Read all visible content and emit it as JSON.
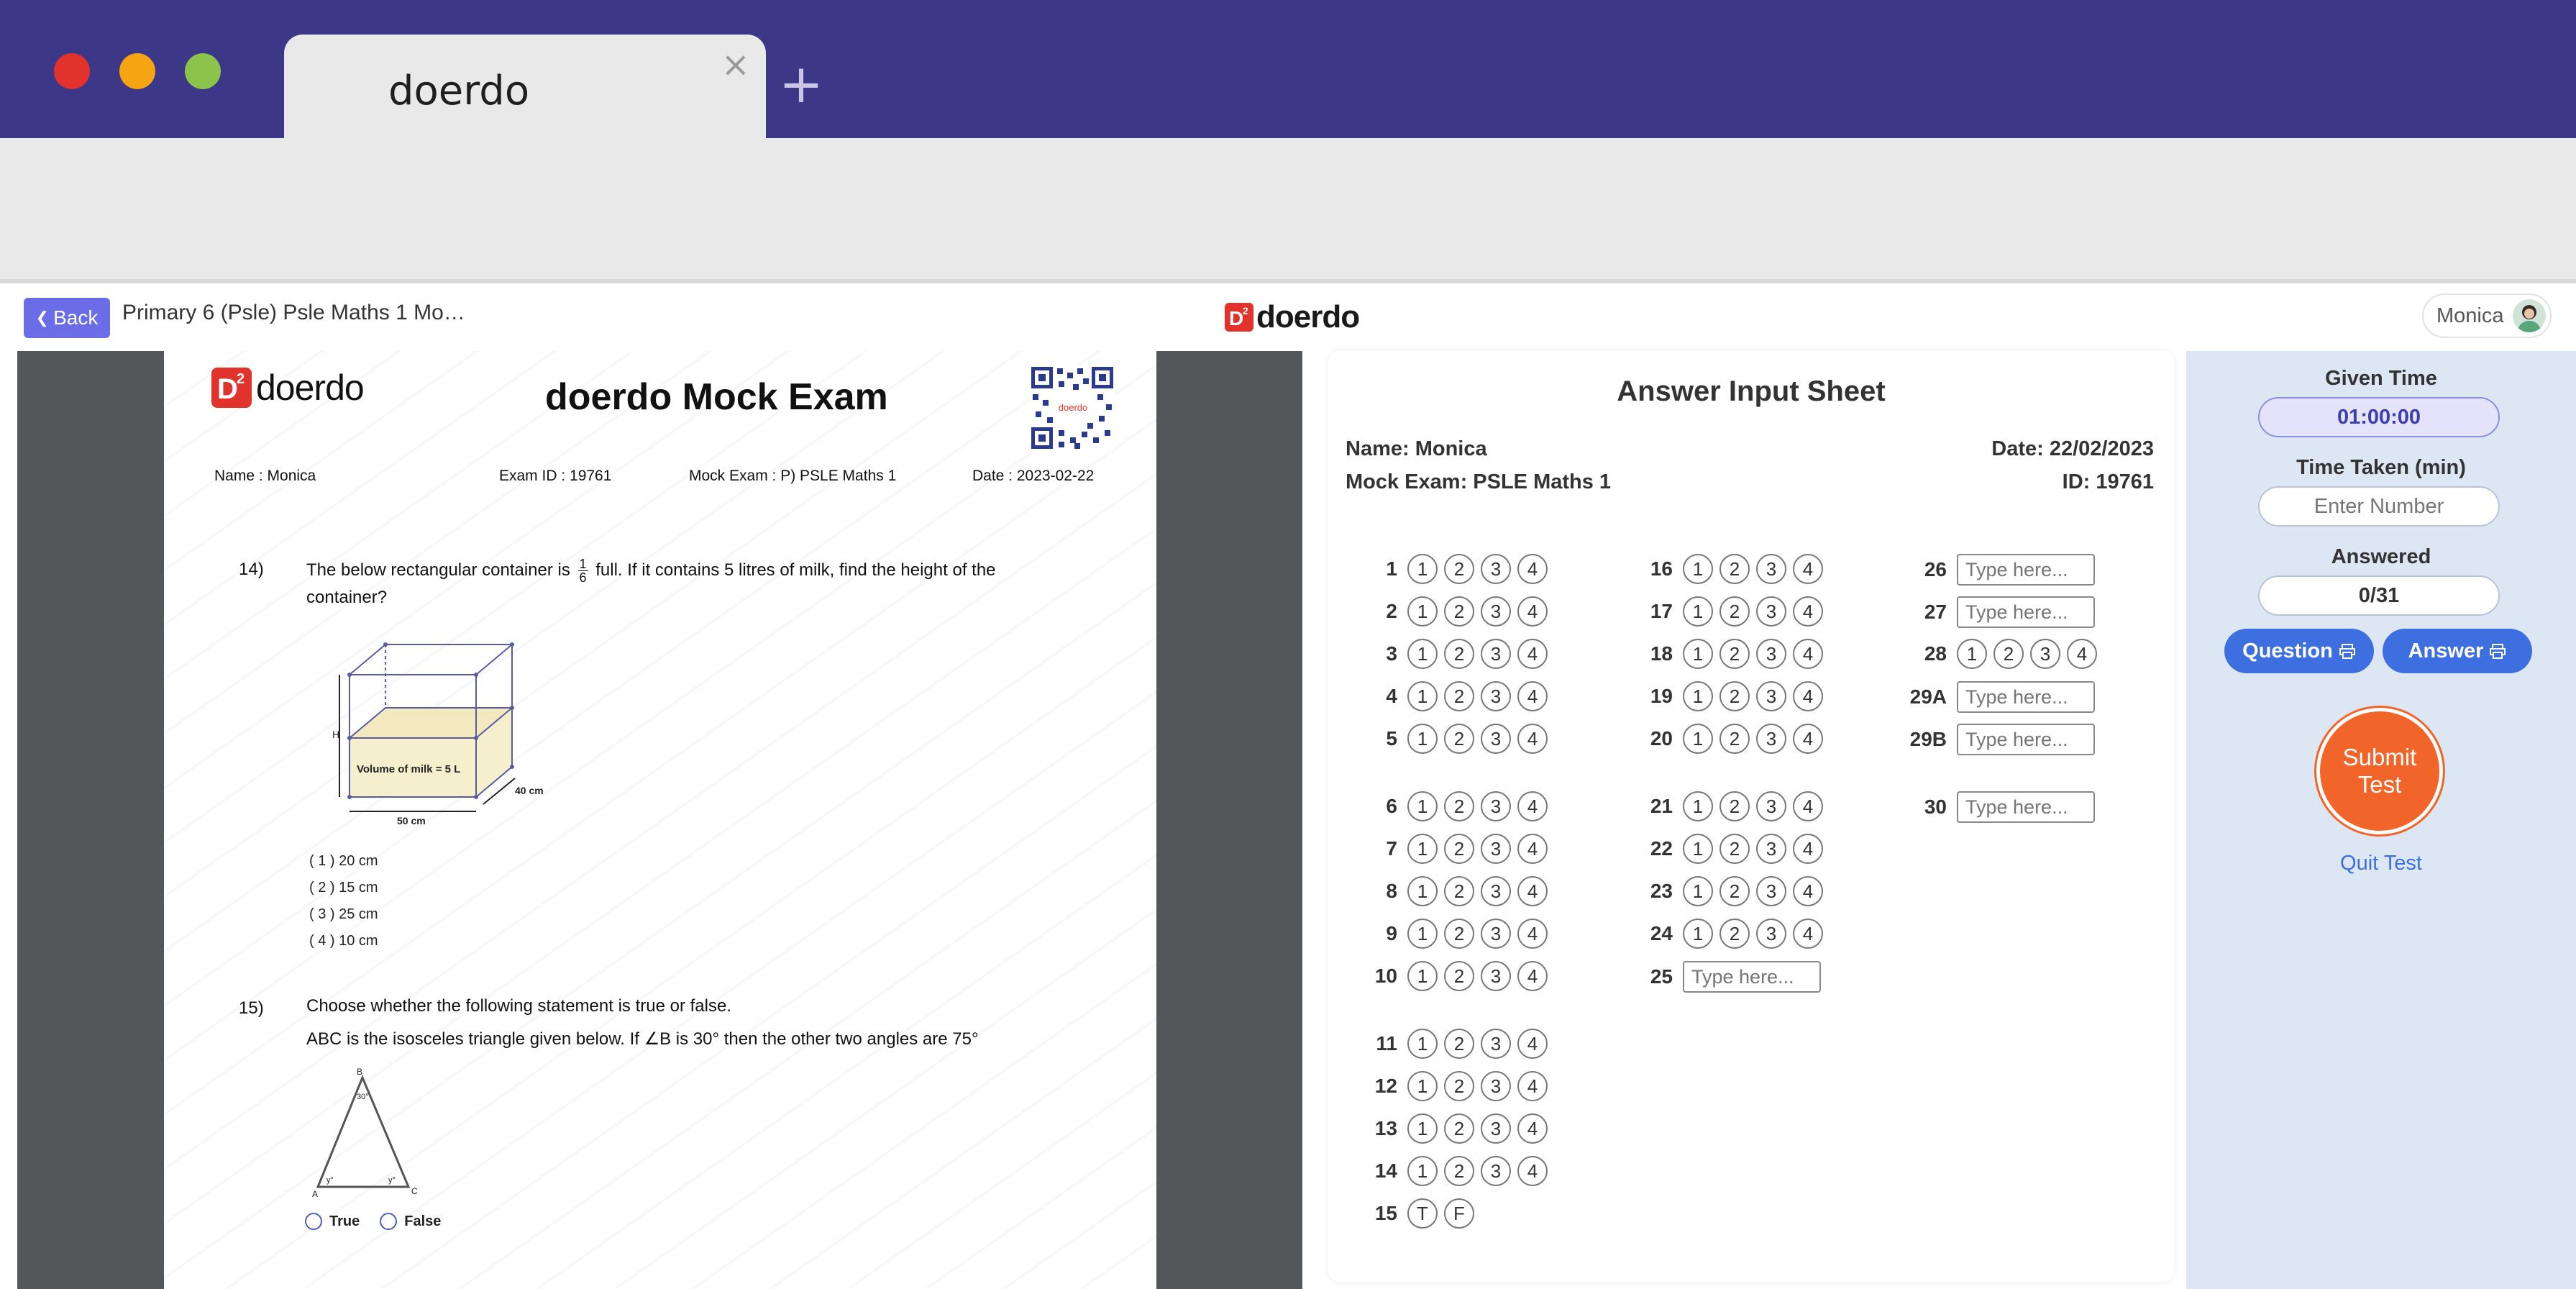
{
  "browser": {
    "tab_title": "doerdo",
    "tab_close": "×",
    "new_tab": "+",
    "url": ""
  },
  "header": {
    "back_label": "Back",
    "doc_title": "Primary 6 (Psle) Psle Maths 1 Mo…",
    "brand": "doerdo",
    "user_name": "Monica"
  },
  "pdf": {
    "logo_text": "doerdo",
    "title": "doerdo Mock Exam",
    "meta": {
      "name": "Name : Monica",
      "exam_id": "Exam ID : 19761",
      "mock_exam": "Mock Exam : P) PSLE Maths 1",
      "date": "Date : 2023-02-22"
    },
    "q14": {
      "num": "14)",
      "text_a": "The below rectangular container is",
      "frac_num": "1",
      "frac_den": "6",
      "text_b": "full. If it contains 5 litres of milk, find the height of the",
      "text_c": "container?",
      "figure": {
        "volume_label": "Volume of milk =   5 L",
        "h_label": "H",
        "width_label": "50 cm",
        "depth_label": "40 cm"
      },
      "options": [
        "( 1 )  20 cm",
        "( 2 )  15 cm",
        "( 3 )  25 cm",
        "( 4 )  10 cm"
      ]
    },
    "q15": {
      "num": "15)",
      "text_a": "Choose whether the following statement is true or false.",
      "text_b": "ABC is the isosceles triangle given below. If ∠B is 30° then the other two angles are 75°",
      "figure": {
        "b": "B",
        "a": "A",
        "c": "C",
        "angle": "30°",
        "y1": "y°",
        "y2": "y°"
      },
      "true_label": "True",
      "false_label": "False"
    }
  },
  "sheet": {
    "title": "Answer Input Sheet",
    "name": "Name: Monica",
    "date": "Date: 22/02/2023",
    "mock_exam": "Mock Exam: PSLE Maths 1",
    "id": "ID: 19761",
    "placeholder": "Type here...",
    "mcq_options": [
      "1",
      "2",
      "3",
      "4"
    ],
    "tf_options": [
      "T",
      "F"
    ],
    "rows": [
      {
        "n": "1"
      },
      {
        "n": "2"
      },
      {
        "n": "3"
      },
      {
        "n": "4"
      },
      {
        "n": "5"
      },
      {
        "n": "6"
      },
      {
        "n": "7"
      },
      {
        "n": "8"
      },
      {
        "n": "9"
      },
      {
        "n": "10"
      },
      {
        "n": "11"
      },
      {
        "n": "12"
      },
      {
        "n": "13"
      },
      {
        "n": "14"
      },
      {
        "n": "15"
      },
      {
        "n": "16"
      },
      {
        "n": "17"
      },
      {
        "n": "18"
      },
      {
        "n": "19"
      },
      {
        "n": "20"
      },
      {
        "n": "21"
      },
      {
        "n": "22"
      },
      {
        "n": "23"
      },
      {
        "n": "24"
      },
      {
        "n": "25"
      },
      {
        "n": "26"
      },
      {
        "n": "27"
      },
      {
        "n": "28"
      },
      {
        "n": "29A"
      },
      {
        "n": "29B"
      },
      {
        "n": "30"
      }
    ]
  },
  "side": {
    "given_time_label": "Given Time",
    "given_time": "01:00:00",
    "time_taken_label": "Time Taken (min)",
    "time_taken_placeholder": "Enter Number",
    "answered_label": "Answered",
    "answered": "0/31",
    "question_btn": "Question",
    "answer_btn": "Answer",
    "submit_line1": "Submit",
    "submit_line2": "Test",
    "quit": "Quit Test"
  },
  "colors": {
    "titlebar": "#3d3788",
    "accent": "#3e6fe0",
    "submit": "#f2652a",
    "back": "#6a6ce8",
    "brand_red": "#e2322c"
  }
}
